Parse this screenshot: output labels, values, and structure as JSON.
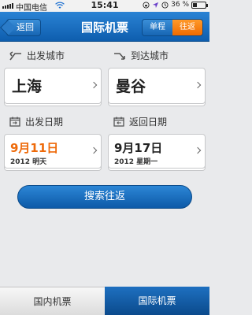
{
  "status_bar": {
    "carrier": "中国电信",
    "time": "15:41",
    "battery_text": "36 %",
    "battery_level": 0.36
  },
  "nav": {
    "back_label": "返回",
    "title": "国际机票",
    "segment_one_way": "单程",
    "segment_round_trip": "往返"
  },
  "form": {
    "from_label": "出发城市",
    "to_label": "到达城市",
    "from_city": "上海",
    "to_city": "曼谷",
    "depart_label": "出发日期",
    "return_label": "返回日期",
    "depart_date": "9月11日",
    "depart_sub": "2012 明天",
    "return_date": "9月17日",
    "return_sub": "2012 星期一"
  },
  "search_button": "搜索往返",
  "tabs": {
    "domestic": "国内机票",
    "international": "国际机票"
  },
  "colors": {
    "nav_blue": "#1766b4",
    "accent_orange": "#ee6a0a"
  }
}
